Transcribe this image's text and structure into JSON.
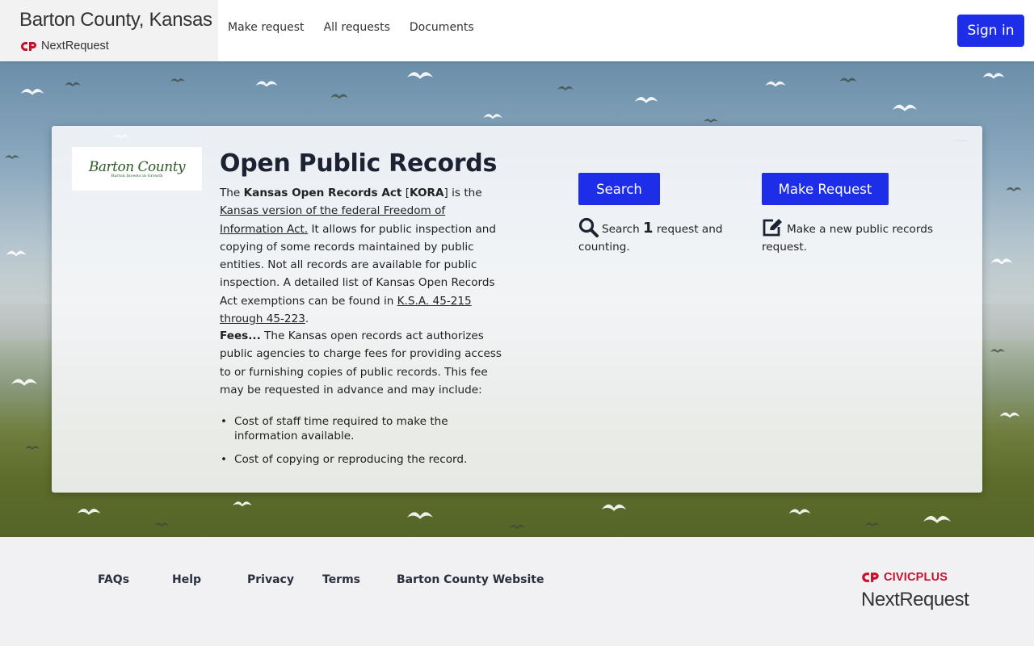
{
  "header": {
    "brand_title": "Barton County, Kansas",
    "brand_sub": "NextRequest",
    "nav": [
      "Make request",
      "All requests",
      "Documents"
    ],
    "signin": "Sign in"
  },
  "card": {
    "logo_text": "Barton County",
    "logo_tagline": "Barton Invests in Growth",
    "title": "Open Public Records",
    "desc": {
      "t1": "The ",
      "b1": "Kansas Open Records Act",
      "t2": " [",
      "b2": "KORA",
      "t3": "] is the ",
      "link1": "Kansas version of the federal Freedom of Information Act.",
      "t4": " It allows for public inspection and copying of some records maintained by public entities. Not all records are available for public inspection. A detailed list of Kansas Open Records Act exemptions can be found in ",
      "link2": "K.S.A. 45-215 through 45-223",
      "t5": "."
    },
    "fees_label": "Fees...",
    "fees_text": " The Kansas open records act authorizes public agencies to charge fees for providing access to or furnishing copies of public records. This fee may be requested in advance and may include:",
    "bullets": [
      "Cost of staff time required to make the information available.",
      "Cost of copying or reproducing the record."
    ],
    "search_button": "Search",
    "search_prefix": "Search ",
    "search_count": "1",
    "search_suffix": " request and counting.",
    "make_button": "Make Request",
    "make_text": "Make a new public records request."
  },
  "footer": {
    "links": [
      "FAQs",
      "Help",
      "Privacy",
      "Terms",
      "Barton County Website"
    ],
    "civic_word": "CIVIC",
    "civic_plus": "PLUS",
    "product": "NextRequest"
  },
  "colors": {
    "accent": "#1d2de8",
    "civic_red": "#c8102e"
  }
}
